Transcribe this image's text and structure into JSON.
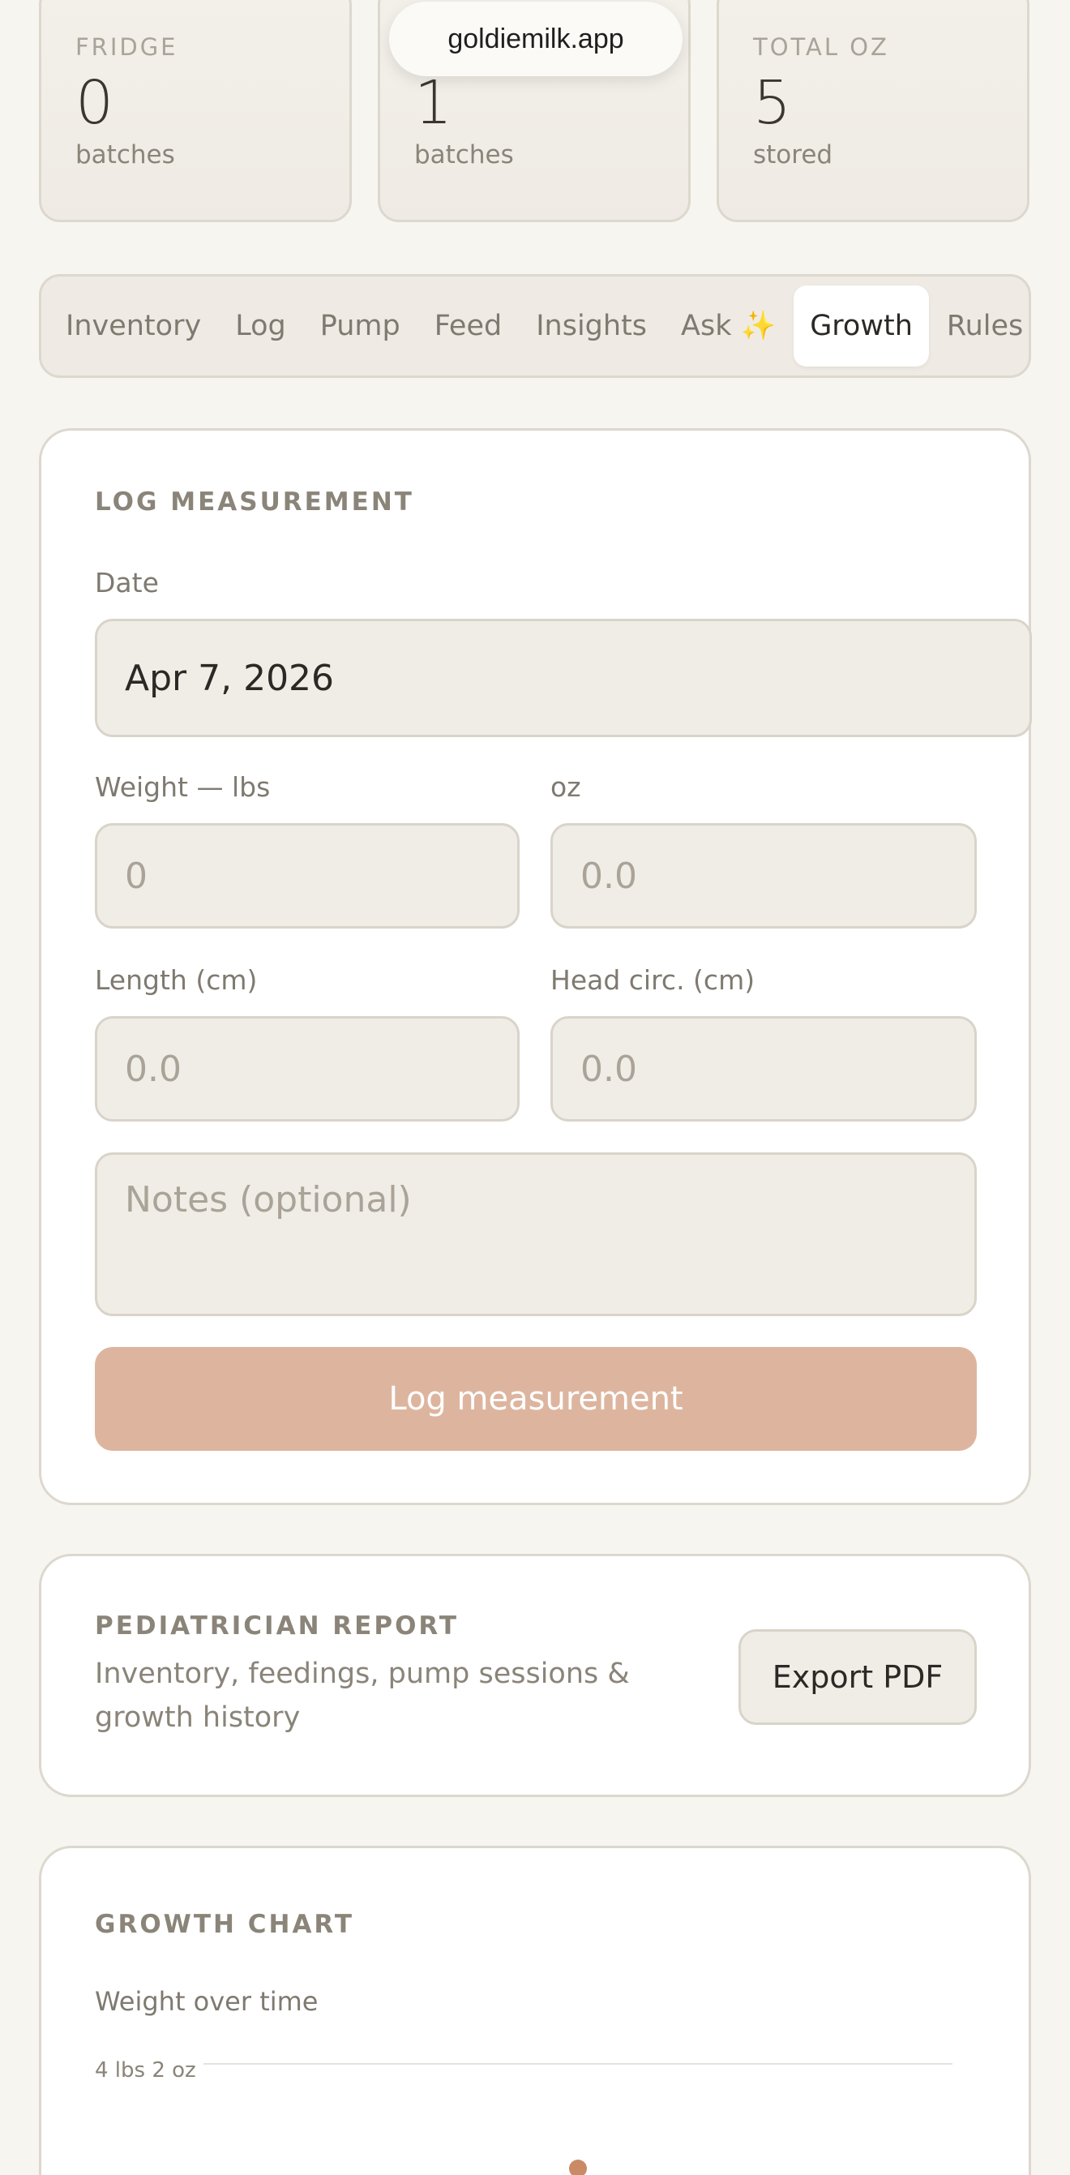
{
  "stats": [
    {
      "label": "FRIDGE",
      "value": "0",
      "unit": "batches"
    },
    {
      "label": "",
      "value": "1",
      "unit": "batches"
    },
    {
      "label": "TOTAL OZ",
      "value": "5",
      "unit": "stored"
    }
  ],
  "browser": {
    "url": "goldiemilk.app"
  },
  "tabs": [
    {
      "label": "Inventory",
      "active": false
    },
    {
      "label": "Log",
      "active": false
    },
    {
      "label": "Pump",
      "active": false
    },
    {
      "label": "Feed",
      "active": false
    },
    {
      "label": "Insights",
      "active": false
    },
    {
      "label": "Ask ✨",
      "active": false
    },
    {
      "label": "Growth",
      "active": true
    },
    {
      "label": "Rules",
      "active": false
    }
  ],
  "log_measurement": {
    "title": "LOG MEASUREMENT",
    "date_label": "Date",
    "date_value": "Apr 7, 2026",
    "weight_lbs_label": "Weight — lbs",
    "weight_lbs_placeholder": "0",
    "weight_oz_label": "oz",
    "weight_oz_placeholder": "0.0",
    "length_label": "Length (cm)",
    "length_placeholder": "0.0",
    "head_label": "Head circ. (cm)",
    "head_placeholder": "0.0",
    "notes_placeholder": "Notes (optional)",
    "submit_label": "Log measurement"
  },
  "report": {
    "title": "PEDIATRICIAN REPORT",
    "description": "Inventory, feedings, pump sessions & growth history",
    "export_label": "Export PDF"
  },
  "growth_chart": {
    "title": "GROWTH CHART",
    "subtitle": "Weight over time",
    "colors": {
      "point": "#c98a66",
      "gridline": "#e6e2da"
    }
  },
  "chart_data": {
    "type": "scatter",
    "title": "",
    "xlabel": "",
    "ylabel": "",
    "y_tick_labels": [
      "4 lbs 2 oz"
    ],
    "series": [
      {
        "values": [
          {
            "x": "Apr 7, 2026",
            "y": "4 lbs 2 oz"
          }
        ]
      }
    ]
  }
}
